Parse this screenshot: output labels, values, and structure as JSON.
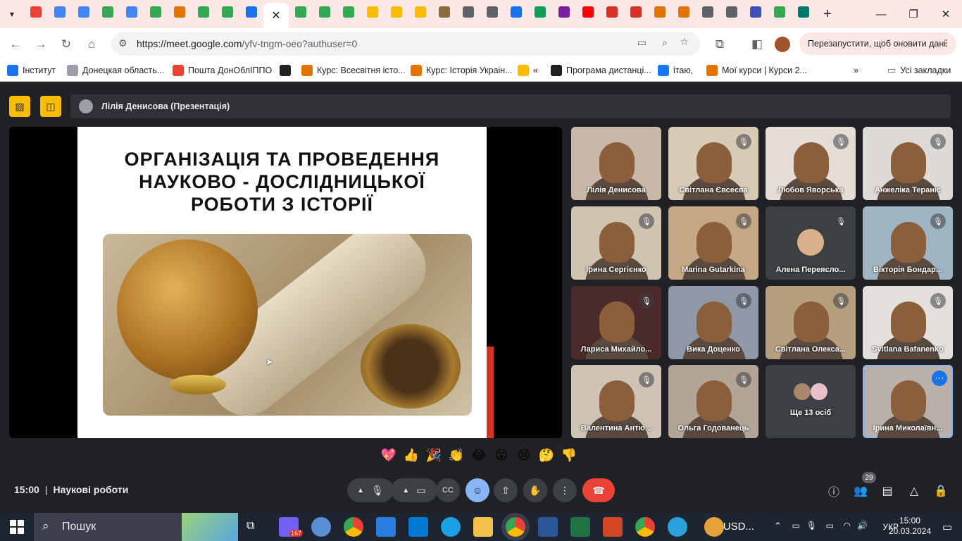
{
  "browser": {
    "url_host": "https://meet.google.com",
    "url_path": "/yfv-tngm-oeo?authuser=0",
    "restart_label": "Перезапустити, щоб оновити дані",
    "tab_colors": [
      "#ea4335",
      "#4285f4",
      "#4285f4",
      "#34a853",
      "#4285f4",
      "#34a853",
      "#e37400",
      "#34a853",
      "#34a853",
      "#1a73e8",
      "#34a853",
      "#34a853",
      "#34a853",
      "#fbbc04",
      "#fbbc04",
      "#fbbc04",
      "#8e6b3e",
      "#5f6368",
      "#5f6368",
      "#1a73e8",
      "#0f9d58",
      "#7b1fa2",
      "#ff0000",
      "#d93025",
      "#d93025",
      "#e37400",
      "#e37400",
      "#5f6368",
      "#5f6368",
      "#3f51b5",
      "#34a853",
      "#00796b"
    ],
    "bookmarks": [
      {
        "label": "Інститут",
        "color": "#1a73e8"
      },
      {
        "label": "Донецкая область...",
        "color": "#9aa0a6"
      },
      {
        "label": "Пошта ДонОблІППО",
        "color": "#ea4335"
      },
      {
        "label": "",
        "color": "#202124"
      },
      {
        "label": "Курс: Всесвітня істо...",
        "color": "#e37400"
      },
      {
        "label": "Курс: Історія Украін...",
        "color": "#e37400"
      },
      {
        "label": "«",
        "color": "#fbbc04"
      },
      {
        "label": "Програма дистанці...",
        "color": "#202124"
      },
      {
        "label": "ітаю,",
        "color": "#1877f2"
      },
      {
        "label": "Мої курси | Курси 2...",
        "color": "#e37400"
      }
    ],
    "all_bookmarks": "Усі закладки"
  },
  "meet": {
    "presenter": "Лілія Денисова (Презентація)",
    "slide_title": "ОРГАНІЗАЦІЯ ТА ПРОВЕДЕННЯ\nНАУКОВО - ДОСЛІДНИЦЬКОЇ\nРОБОТИ З ІСТОРІЇ",
    "participants": [
      {
        "name": "Лілія Денисова",
        "muted": false,
        "bg": "#c9b8a8"
      },
      {
        "name": "Світлана Євсеєва",
        "muted": true,
        "bg": "#d8cbb6"
      },
      {
        "name": "Любов Яворська",
        "muted": true,
        "bg": "#e3ddd6"
      },
      {
        "name": "Анжеліка Тераніс",
        "muted": true,
        "bg": "#dedbd6"
      },
      {
        "name": "Ірина Сергієнко",
        "muted": true,
        "bg": "#cfc4b0"
      },
      {
        "name": "Marina Gutarkina",
        "muted": true,
        "bg": "#c4a783"
      },
      {
        "name": "Алена Переясло...",
        "muted": true,
        "bg": "#3c4043",
        "avatar": true
      },
      {
        "name": "Вікторія Бондар...",
        "muted": true,
        "bg": "#9fb5c4"
      },
      {
        "name": "Лариса Михайло...",
        "muted": true,
        "bg": "#4a2a2a"
      },
      {
        "name": "Вика Доценко",
        "muted": true,
        "bg": "#8f98a6"
      },
      {
        "name": "Світлана Олекса...",
        "muted": true,
        "bg": "#b59f7f"
      },
      {
        "name": "Svitlana Bafanenko",
        "muted": true,
        "bg": "#e3e0dc"
      },
      {
        "name": "Валентина Антю...",
        "muted": true,
        "bg": "#cfc3b6"
      },
      {
        "name": "Ольга Годованець",
        "muted": true,
        "bg": "#b3a596"
      },
      {
        "name": "Ще 13 осіб",
        "muted": false,
        "bg": "#3c4043",
        "others": true
      },
      {
        "name": "Ірина Миколаївн...",
        "muted": false,
        "bg": "#b7b0ab",
        "self": true
      }
    ],
    "reactions": [
      "💖",
      "👍",
      "🎉",
      "👏",
      "😂",
      "😮",
      "😢",
      "🤔",
      "👎"
    ],
    "time": "15:00",
    "meeting_name": "Наукові роботи",
    "participant_count": "29"
  },
  "taskbar": {
    "search": "Пошук",
    "viber_badge": "167",
    "tray_label": "USD...",
    "lang": "УКР",
    "clock_time": "15:00",
    "clock_date": "20.03.2024"
  }
}
